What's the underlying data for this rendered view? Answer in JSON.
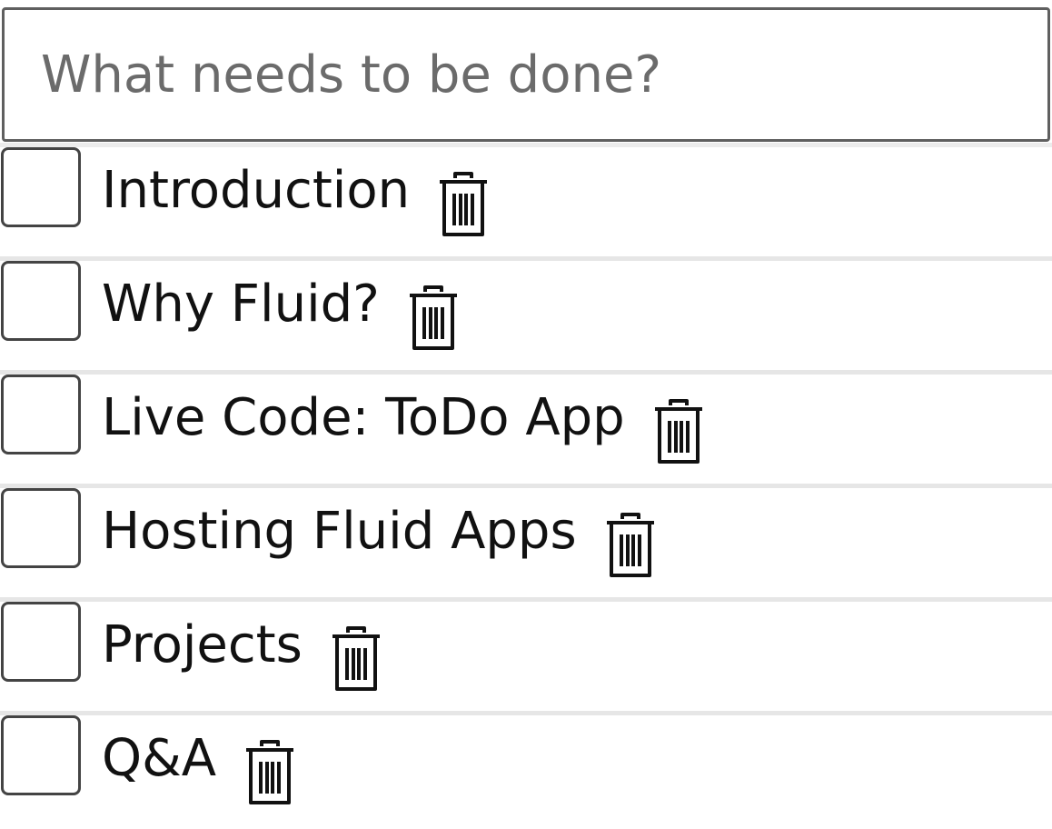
{
  "new_todo": {
    "placeholder": "What needs to be done?",
    "value": ""
  },
  "todos": [
    {
      "label": "Introduction",
      "completed": false,
      "delete_icon": "trash-icon"
    },
    {
      "label": "Why Fluid?",
      "completed": false,
      "delete_icon": "trash-icon"
    },
    {
      "label": "Live Code: ToDo App",
      "completed": false,
      "delete_icon": "trash-icon"
    },
    {
      "label": "Hosting Fluid Apps",
      "completed": false,
      "delete_icon": "trash-icon"
    },
    {
      "label": "Projects",
      "completed": false,
      "delete_icon": "trash-icon"
    },
    {
      "label": "Q&A",
      "completed": false,
      "delete_icon": "trash-icon"
    }
  ],
  "colors": {
    "input_border": "#5f5f5f",
    "placeholder": "#6b6b6b",
    "divider": "#e6e6e6",
    "checkbox_border": "#444444",
    "text": "#111111"
  }
}
